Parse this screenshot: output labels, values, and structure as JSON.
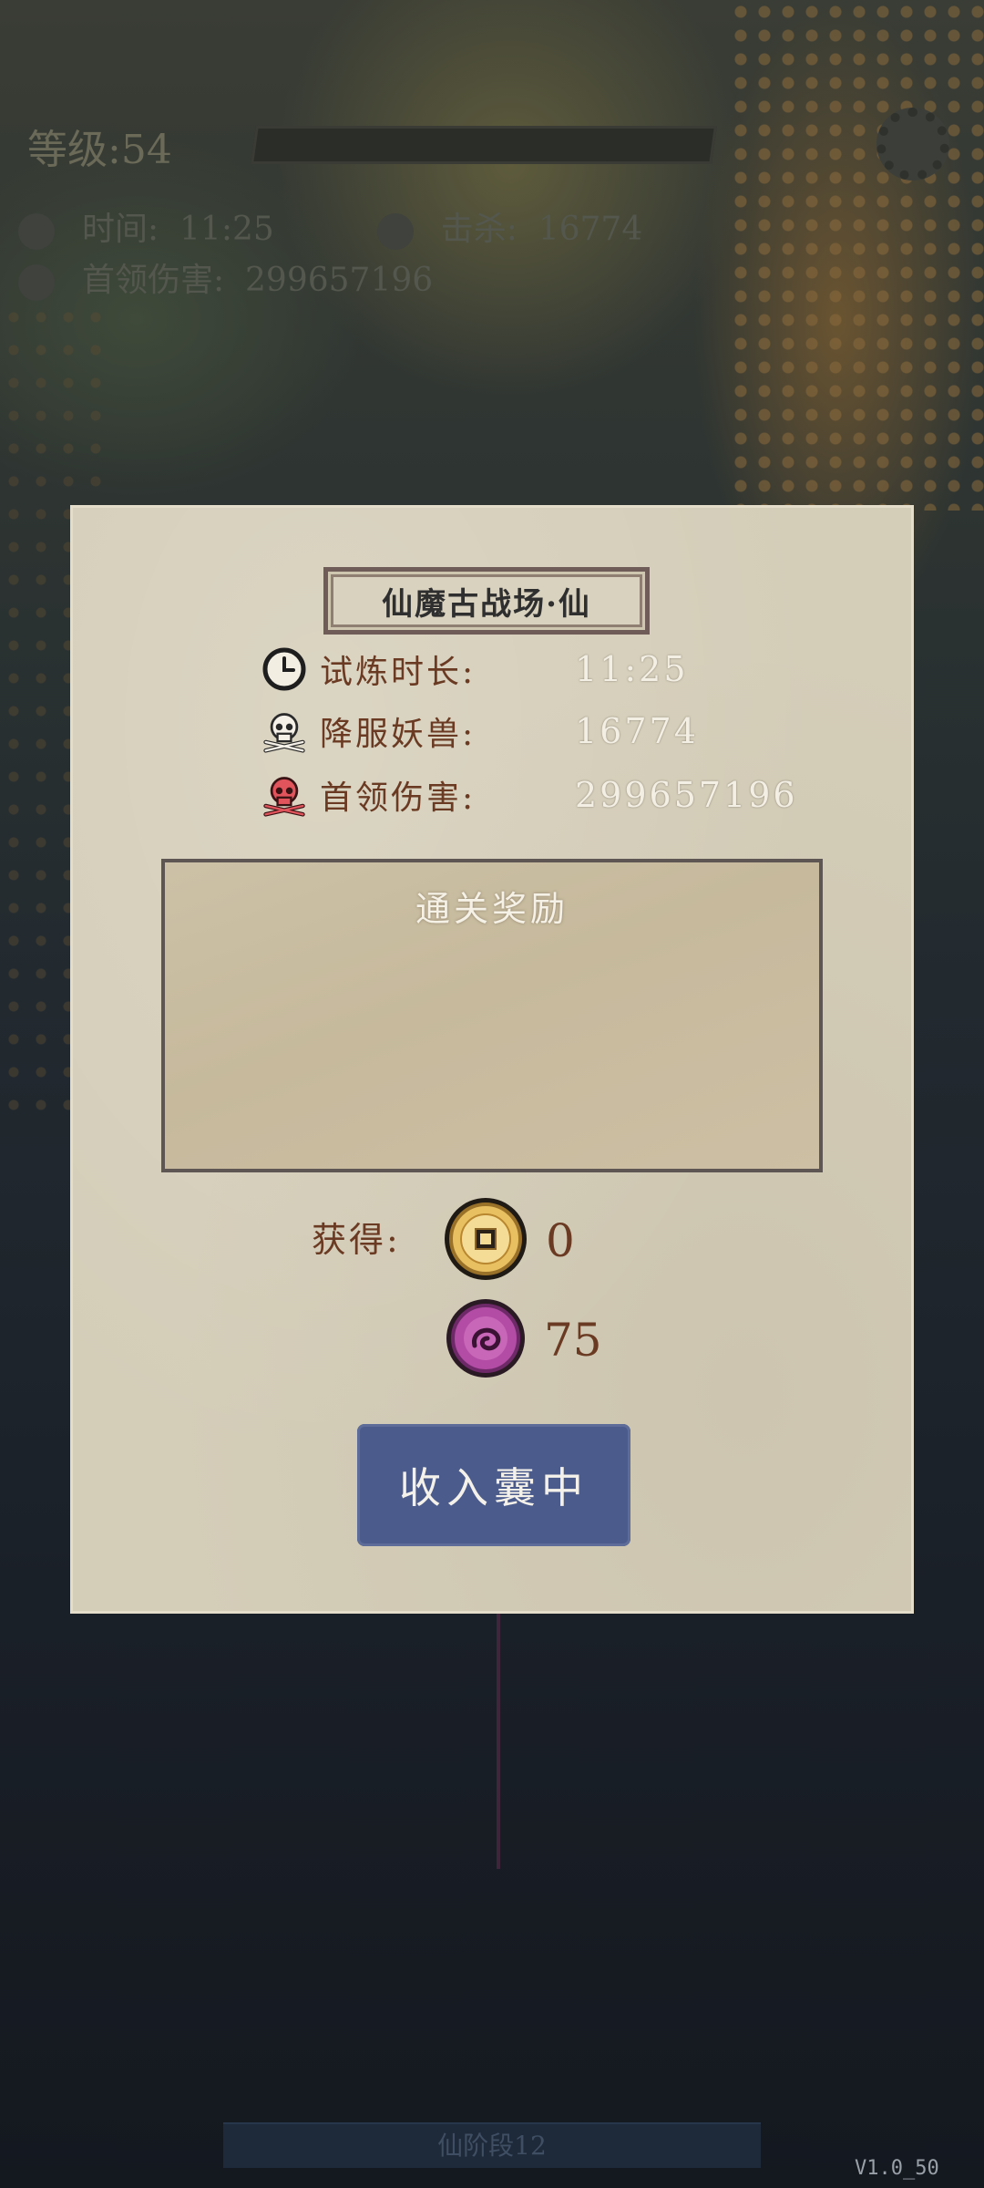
{
  "background": {
    "level_text": "等级:54",
    "time_label": "时间:",
    "time_value": "11:25",
    "kills_label": "击杀:",
    "kills_value": "16774",
    "boss_label": "首领伤害:",
    "boss_value": "299657196",
    "stage_label": "仙阶段12",
    "version": "V1.0_50"
  },
  "panel": {
    "title": "仙魔古战场·仙",
    "stats": [
      {
        "icon": "clock-icon",
        "label": "试炼时长:",
        "value": "11:25"
      },
      {
        "icon": "skull-icon",
        "label": "降服妖兽:",
        "value": "16774"
      },
      {
        "icon": "red-skull-icon",
        "label": "首领伤害:",
        "value": "299657196"
      }
    ],
    "rewards_title": "通关奖励",
    "obtain_label": "获得:",
    "resources": [
      {
        "icon": "copper-coin-icon",
        "amount": "0"
      },
      {
        "icon": "purple-spirit-orb-icon",
        "amount": "75"
      }
    ],
    "collect_button": "收入囊中"
  },
  "colors": {
    "panel_bg": "#d4cdb8",
    "label_brown": "#6a3a22",
    "button_blue": "#4b5b8c"
  }
}
